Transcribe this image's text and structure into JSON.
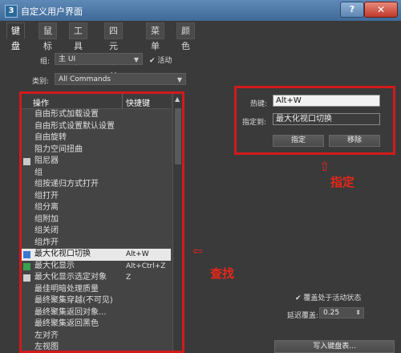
{
  "window": {
    "app_icon": "3",
    "title": "自定义用户界面",
    "help_label": "?",
    "close_label": "✕"
  },
  "tabs": [
    "键盘",
    "鼠标",
    "工具栏",
    "四元菜单",
    "菜单",
    "颜色"
  ],
  "group": {
    "label": "组:",
    "value": "主 UI",
    "active_label": "活动",
    "active_checked": true
  },
  "category": {
    "label": "类别:",
    "value": "All Commands"
  },
  "list": {
    "col_action": "操作",
    "col_shortcut": "快捷键",
    "rows": [
      {
        "name": "自由形式加载设置",
        "key": "",
        "icon": ""
      },
      {
        "name": "自由形式设置默认设置",
        "key": "",
        "icon": ""
      },
      {
        "name": "自由旋转",
        "key": "",
        "icon": ""
      },
      {
        "name": "阻力空间扭曲",
        "key": "",
        "icon": ""
      },
      {
        "name": "阻尼器",
        "key": "",
        "icon": "damper-icon"
      },
      {
        "name": "组",
        "key": "",
        "icon": ""
      },
      {
        "name": "组按递归方式打开",
        "key": "",
        "icon": ""
      },
      {
        "name": "组打开",
        "key": "",
        "icon": ""
      },
      {
        "name": "组分离",
        "key": "",
        "icon": ""
      },
      {
        "name": "组附加",
        "key": "",
        "icon": ""
      },
      {
        "name": "组关闭",
        "key": "",
        "icon": ""
      },
      {
        "name": "组炸开",
        "key": "",
        "icon": ""
      },
      {
        "name": "最大化视口切换",
        "key": "Alt+W",
        "icon": "maximize-viewport-icon",
        "selected": true
      },
      {
        "name": "最大化显示",
        "key": "Alt+Ctrl+Z",
        "icon": "zoom-extents-icon"
      },
      {
        "name": "最大化显示选定对象",
        "key": "Z",
        "icon": "zoom-selected-icon"
      },
      {
        "name": "最佳明暗处理质量",
        "key": "",
        "icon": ""
      },
      {
        "name": "最终聚集穿越(不可见)",
        "key": "",
        "icon": ""
      },
      {
        "name": "最终聚集返回对象...",
        "key": "",
        "icon": ""
      },
      {
        "name": "最终聚集返回黑色",
        "key": "",
        "icon": ""
      },
      {
        "name": "左对齐",
        "key": "",
        "icon": ""
      },
      {
        "name": "左视图",
        "key": "",
        "icon": ""
      }
    ]
  },
  "assign": {
    "hotkey_label": "热键:",
    "hotkey_value": "Alt+W",
    "assigned_to_label": "指定到:",
    "assigned_to_value": "最大化视口切换",
    "assign_button": "指定",
    "remove_button": "移除"
  },
  "options": {
    "override_label": "覆盖处于活动状态",
    "override_checked": true,
    "delay_label": "延迟覆盖:",
    "delay_value": "0.25"
  },
  "write_keyboard_button": "写入键盘表...",
  "annotations": {
    "assign_note": "指定",
    "find_note": "查找",
    "color": "#e8261a"
  }
}
